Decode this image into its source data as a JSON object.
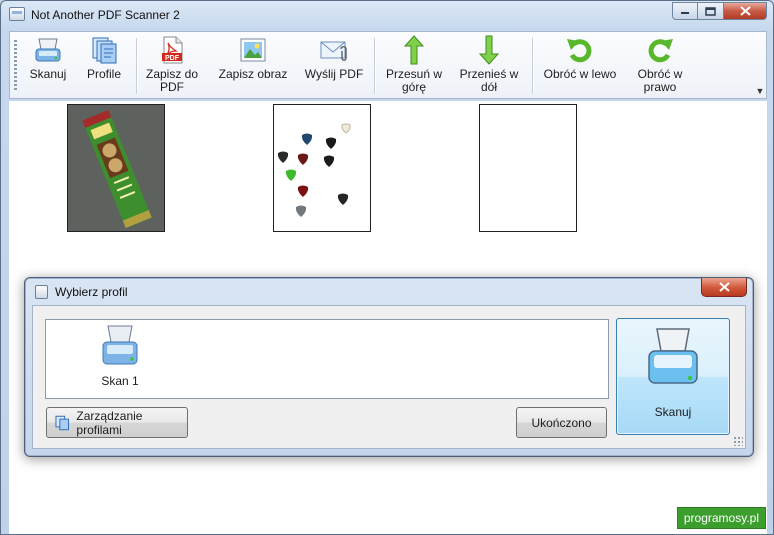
{
  "window": {
    "title": "Not Another PDF Scanner 2",
    "controls": [
      "minimize",
      "maximize",
      "close"
    ]
  },
  "toolbar": {
    "buttons": [
      {
        "id": "scan",
        "label": "Skanuj",
        "icon": "scanner-icon"
      },
      {
        "id": "profiles",
        "label": "Profile",
        "icon": "profiles-icon"
      },
      {
        "id": "save_pdf",
        "label": "Zapisz do PDF",
        "icon": "pdf-file-icon"
      },
      {
        "id": "save_image",
        "label": "Zapisz obraz",
        "icon": "image-icon"
      },
      {
        "id": "email_pdf",
        "label": "Wyślij PDF",
        "icon": "email-icon"
      },
      {
        "id": "move_up",
        "label": "Przesuń w górę",
        "icon": "arrow-up-icon"
      },
      {
        "id": "move_down",
        "label": "Przenieś w dół",
        "icon": "arrow-down-icon"
      },
      {
        "id": "rotate_left",
        "label": "Obróć w lewo",
        "icon": "rotate-left-icon"
      },
      {
        "id": "rotate_right",
        "label": "Obróć w prawo",
        "icon": "rotate-right-icon"
      }
    ]
  },
  "pages": [
    {
      "name": "page-1",
      "content": "scanned-snack-bar"
    },
    {
      "name": "page-2",
      "content": "scanned-guitar-picks"
    },
    {
      "name": "page-3",
      "content": "blank"
    }
  ],
  "dialog": {
    "title": "Wybierz profil",
    "profiles": [
      {
        "label": "Skan 1",
        "icon": "scanner-icon"
      }
    ],
    "manage_profiles_label": "Zarządzanie profilami",
    "done_label": "Ukończono",
    "scan_label": "Skanuj"
  },
  "watermark": "programosy.pl",
  "colors": {
    "accent": "#3c7fb1",
    "title_bar": "#c6d8ee",
    "close_button": "#c75a45",
    "watermark": "#3c9f2d"
  }
}
